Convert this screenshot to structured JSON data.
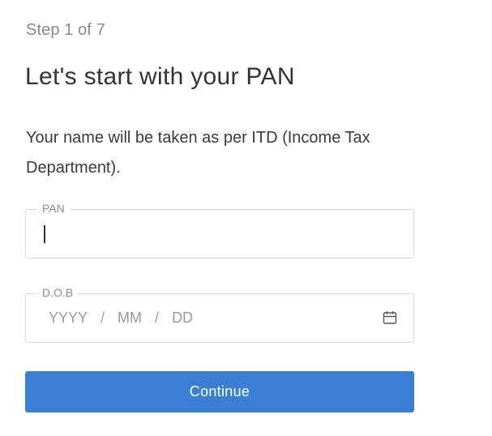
{
  "step": {
    "label": "Step 1 of 7"
  },
  "header": {
    "title": "Let's start with your PAN"
  },
  "description": "Your name will be taken as per ITD (Income Tax Department).",
  "form": {
    "pan": {
      "label": "PAN",
      "value": ""
    },
    "dob": {
      "label": "D.O.B",
      "placeholder_year": "YYYY",
      "placeholder_month": "MM",
      "placeholder_day": "DD",
      "separator": "/",
      "icon": "calendar-icon"
    }
  },
  "actions": {
    "continue_label": "Continue"
  },
  "colors": {
    "primary_button": "#3b7fd4",
    "border": "#d9d9d9",
    "muted_text": "#8a8a8a"
  }
}
